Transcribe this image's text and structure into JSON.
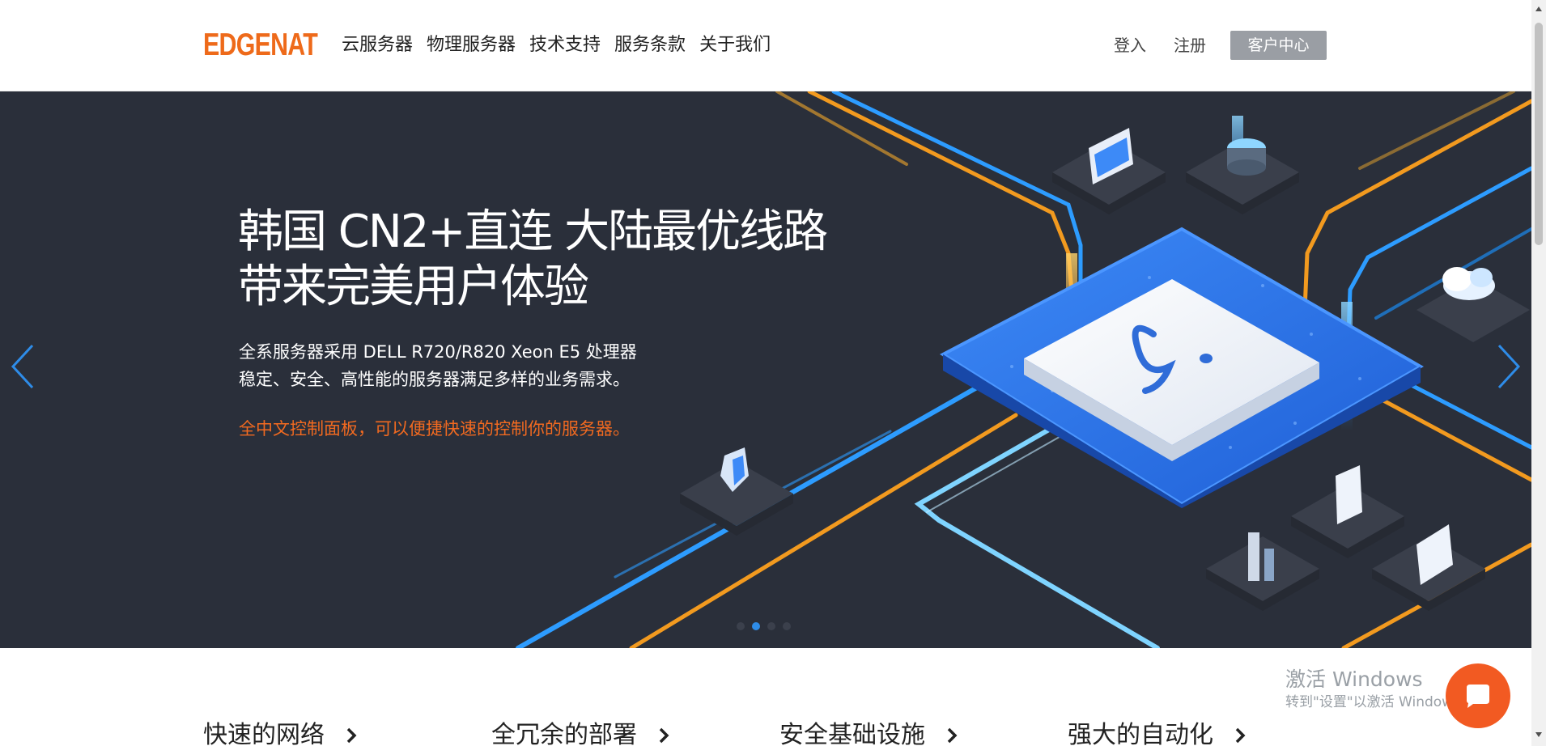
{
  "header": {
    "logo": "EDGENAT",
    "nav": [
      "云服务器",
      "物理服务器",
      "技术支持",
      "服务条款",
      "关于我们"
    ],
    "login_label": "登入",
    "register_label": "注册",
    "client_center_label": "客户中心"
  },
  "hero": {
    "title_line1": "韩国 CN2+直连 大陆最优线路",
    "title_line2": "带来完美用户体验",
    "desc_line1": "全系服务器采用 DELL R720/R820 Xeon E5 处理器",
    "desc_line2": "稳定、安全、高性能的服务器满足多样的业务需求。",
    "highlight": "全中文控制面板，可以便捷快速的控制你的服务器。",
    "slide_count": 4,
    "active_slide": 2
  },
  "features": [
    "快速的网络",
    "全冗余的部署",
    "安全基础设施",
    "强大的自动化"
  ],
  "watermark": {
    "title": "激活 Windows",
    "subtitle": "转到\"设置\"以激活 Windows。"
  },
  "colors": {
    "accent": "#ee6a1a",
    "hero_bg": "#2a2f3a",
    "highlight": "#f26a20",
    "dot_active": "#2e8ce8",
    "button_gray": "#9a9ea4",
    "chat": "#f25a22"
  },
  "icons": {
    "prev": "chevron-left-icon",
    "next": "chevron-right-icon",
    "feature": "chevron-right-icon",
    "chat": "chat-bubble-icon"
  }
}
